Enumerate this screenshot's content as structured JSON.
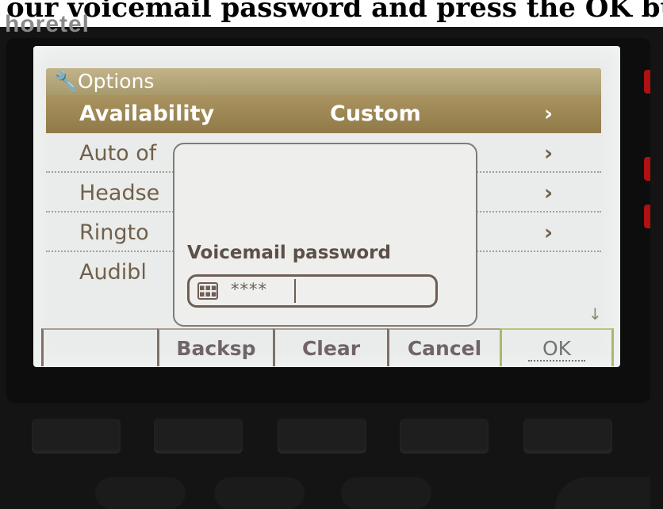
{
  "caption": "our voicemail password and press the OK button.",
  "brand": "horetel",
  "screen": {
    "header": {
      "icon": "wrench-icon",
      "glyph": "🔧",
      "title": "Options"
    },
    "menu_items": [
      {
        "label": "Availability",
        "value": "Custom",
        "chevron": "›",
        "selected": true
      },
      {
        "label": "Auto of",
        "value": "",
        "chevron": "›"
      },
      {
        "label": "Headse",
        "value": "",
        "chevron": "›"
      },
      {
        "label": "Ringto",
        "value": "",
        "chevron": "›"
      },
      {
        "label": "Audibl",
        "value": "",
        "chevron": ""
      }
    ],
    "scroll_indicator": "↓",
    "dialog": {
      "prompt": "Voicemail password",
      "keypad_icon": "keypad-icon",
      "keypad_glyph": "▪▪▪\n▪▪▪",
      "masked_value": "****"
    },
    "softkeys": [
      "",
      "Backsp",
      "Clear",
      "Cancel",
      "OK"
    ]
  },
  "colors": {
    "header_accent": "#a89a6c",
    "selected_row": "#9a844f",
    "ok_accent": "#a9b86c"
  }
}
